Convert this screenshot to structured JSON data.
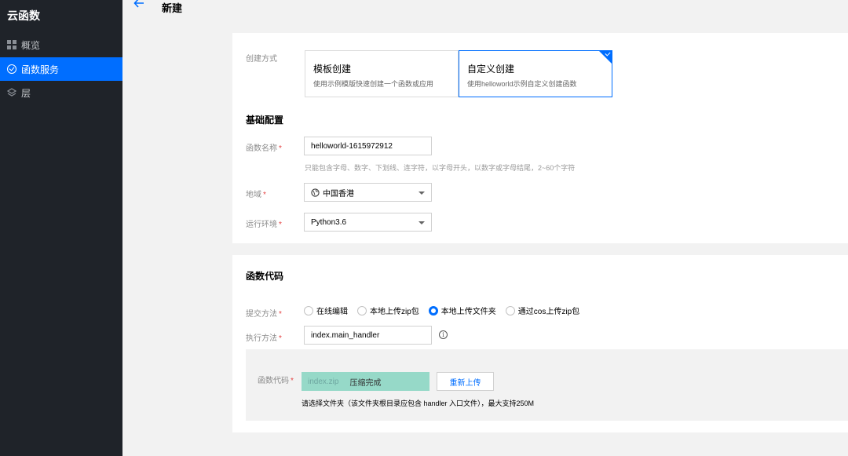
{
  "sidebar": {
    "title": "云函数",
    "items": [
      {
        "label": "概览",
        "icon": "overview-grid-icon",
        "active": false
      },
      {
        "label": "函数服务",
        "icon": "function-service-icon",
        "active": true
      },
      {
        "label": "层",
        "icon": "layer-icon",
        "active": false
      }
    ]
  },
  "header": {
    "back_icon": "arrow-left-icon",
    "title": "新建"
  },
  "create_method": {
    "label": "创建方式",
    "options": [
      {
        "title": "模板创建",
        "desc": "使用示例模版快速创建一个函数或应用",
        "selected": false
      },
      {
        "title": "自定义创建",
        "desc": "使用helloworld示例自定义创建函数",
        "selected": true
      }
    ]
  },
  "basic": {
    "section_title": "基础配置",
    "function_name": {
      "label": "函数名称",
      "value": "helloworld-1615972912",
      "hint": "只能包含字母、数字、下划线、连字符，以字母开头，以数字或字母结尾，2~60个字符"
    },
    "region": {
      "label": "地域",
      "value": "中国香港",
      "icon": "globe-icon"
    },
    "runtime": {
      "label": "运行环境",
      "value": "Python3.6"
    }
  },
  "code": {
    "section_title": "函数代码",
    "submit_method": {
      "label": "提交方法",
      "options": [
        {
          "label": "在线编辑",
          "checked": false
        },
        {
          "label": "本地上传zip包",
          "checked": false
        },
        {
          "label": "本地上传文件夹",
          "checked": true
        },
        {
          "label": "通过cos上传zip包",
          "checked": false
        }
      ]
    },
    "handler": {
      "label": "执行方法",
      "value": "index.main_handler"
    },
    "upload": {
      "label": "函数代码",
      "filename": "index.zip",
      "status": "压缩完成",
      "button": "重新上传",
      "note": "请选择文件夹（该文件夹根目录应包含 handler 入口文件），最大支持250M"
    }
  },
  "colors": {
    "accent": "#006eff",
    "sidebar_bg": "#1f2329",
    "upload_done": "#96d9c8",
    "required": "#e54545"
  }
}
